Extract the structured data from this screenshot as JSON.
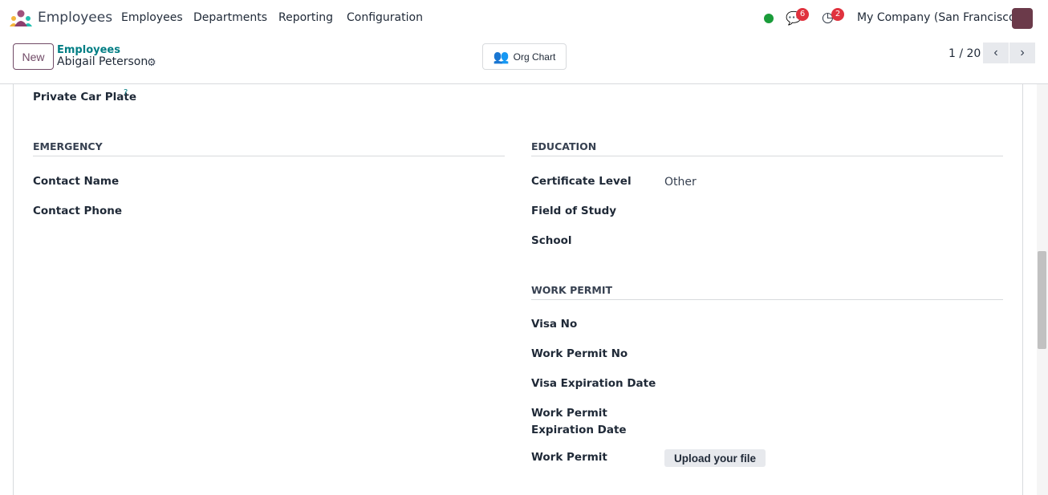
{
  "nav": {
    "app": "Employees",
    "menu": [
      "Employees",
      "Departments",
      "Reporting",
      "Configuration"
    ],
    "messages_count": "6",
    "activities_count": "2",
    "company": "My Company (San Francisco)",
    "status_color": "#1a9c3a"
  },
  "control": {
    "new": "New",
    "breadcrumb_parent": "Employees",
    "record": "Abigail Peterson",
    "org_chart": "Org Chart",
    "pager": "1 / 20"
  },
  "form": {
    "private_car_plate": "Private Car Plate",
    "help": "?",
    "emergency": {
      "title": "EMERGENCY",
      "contact_name": "Contact Name",
      "contact_phone": "Contact Phone"
    },
    "education": {
      "title": "EDUCATION",
      "certificate_level": "Certificate Level",
      "certificate_value": "Other",
      "field_of_study": "Field of Study",
      "school": "School"
    },
    "work_permit": {
      "title": "WORK PERMIT",
      "visa_no": "Visa No",
      "work_permit_no": "Work Permit No",
      "visa_expiration": "Visa Expiration Date",
      "permit_expiration_1": "Work Permit",
      "permit_expiration_2": "Expiration Date",
      "work_permit": "Work Permit",
      "upload": "Upload your file"
    }
  }
}
